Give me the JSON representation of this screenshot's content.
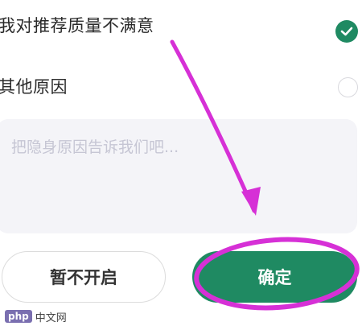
{
  "options": [
    {
      "label": "我对推荐质量不满意",
      "checked": true
    },
    {
      "label": "其他原因",
      "checked": false
    }
  ],
  "reason": {
    "placeholder": "把隐身原因告诉我们吧...",
    "value": ""
  },
  "buttons": {
    "secondary_label": "暂不开启",
    "primary_label": "确定"
  },
  "annotation": {
    "color": "#d630d6"
  },
  "watermark": {
    "logo": "php",
    "text": "中文网"
  },
  "colors": {
    "accent": "#1f8a62",
    "input_bg": "#f4f4f8",
    "placeholder": "#c6c6d4"
  }
}
